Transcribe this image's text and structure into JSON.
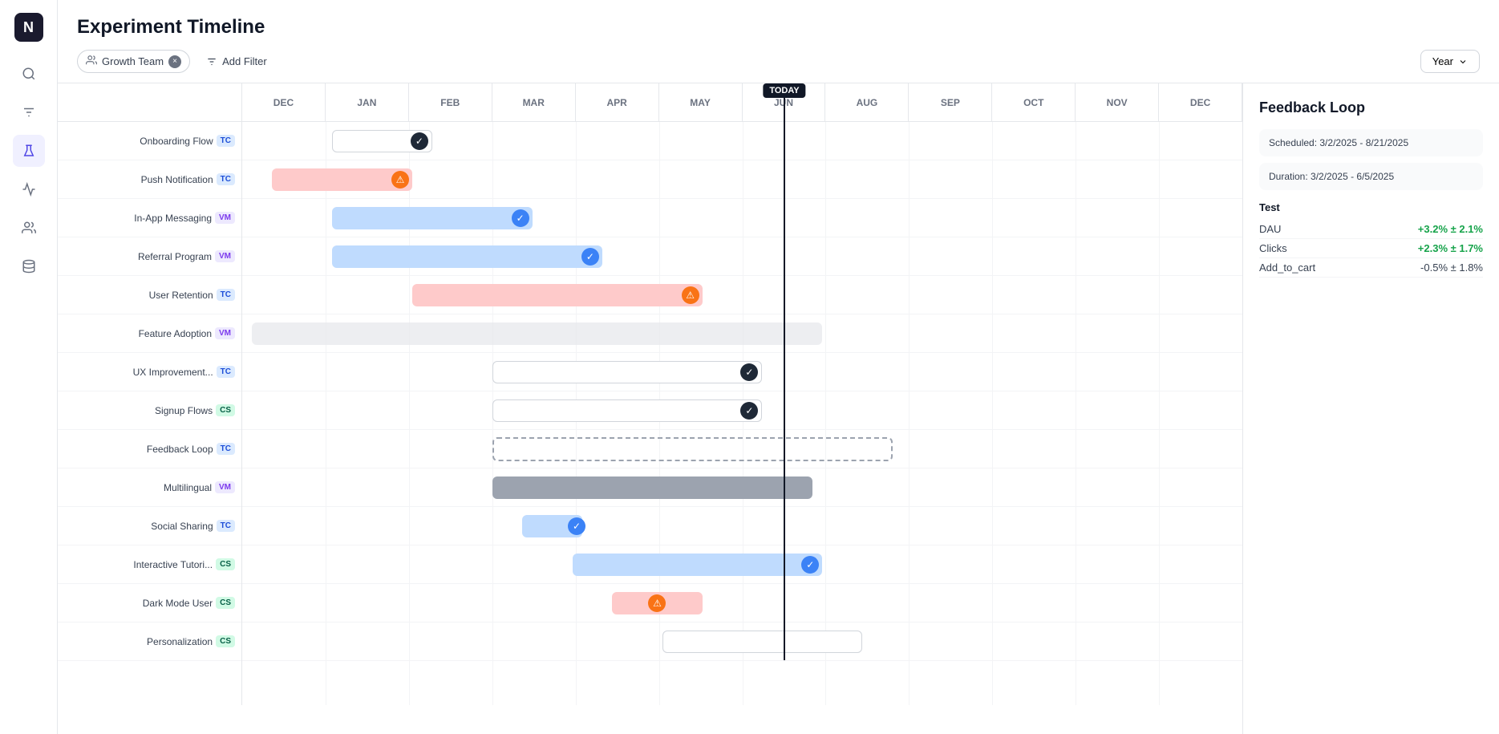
{
  "app": {
    "logo": "N",
    "title": "Experiment Timeline"
  },
  "sidebar": {
    "icons": [
      {
        "name": "search-icon",
        "symbol": "🔍"
      },
      {
        "name": "filter-icon",
        "symbol": "⚙️"
      },
      {
        "name": "experiment-icon",
        "symbol": "🧪",
        "active": true
      },
      {
        "name": "analytics-icon",
        "symbol": "📈"
      },
      {
        "name": "team-icon",
        "symbol": "👥"
      },
      {
        "name": "database-icon",
        "symbol": "🗄️"
      }
    ]
  },
  "header": {
    "title": "Experiment Timeline",
    "filter_chip_label": "Growth Team",
    "filter_chip_close": "×",
    "add_filter_label": "Add Filter",
    "year_label": "Year"
  },
  "months": [
    "DEC",
    "JAN",
    "FEB",
    "MAR",
    "APR",
    "MAY",
    "JUN",
    "AUG",
    "SEP",
    "OCT",
    "NOV",
    "DEC"
  ],
  "today_label": "TODAY",
  "rows": [
    {
      "label": "Onboarding Flow",
      "tag": "TC",
      "tag_class": "tag-tc"
    },
    {
      "label": "Push Notification",
      "tag": "TC",
      "tag_class": "tag-tc"
    },
    {
      "label": "In-App Messaging",
      "tag": "VM",
      "tag_class": "tag-vm"
    },
    {
      "label": "Referral Program",
      "tag": "VM",
      "tag_class": "tag-vm"
    },
    {
      "label": "User Retention",
      "tag": "TC",
      "tag_class": "tag-tc"
    },
    {
      "label": "Feature Adoption",
      "tag": "VM",
      "tag_class": "tag-vm"
    },
    {
      "label": "UX Improvement...",
      "tag": "TC",
      "tag_class": "tag-tc"
    },
    {
      "label": "Signup Flows",
      "tag": "CS",
      "tag_class": "tag-cs"
    },
    {
      "label": "Feedback Loop",
      "tag": "TC",
      "tag_class": "tag-tc"
    },
    {
      "label": "Multilingual",
      "tag": "VM",
      "tag_class": "tag-vm"
    },
    {
      "label": "Social Sharing",
      "tag": "TC",
      "tag_class": "tag-tc"
    },
    {
      "label": "Interactive Tutori...",
      "tag": "CS",
      "tag_class": "tag-cs"
    },
    {
      "label": "Dark Mode User",
      "tag": "CS",
      "tag_class": "tag-cs"
    },
    {
      "label": "Personalization",
      "tag": "CS",
      "tag_class": "tag-cs"
    }
  ],
  "popup": {
    "title": "Feedback Loop",
    "scheduled": "Scheduled: 3/2/2025 - 8/21/2025",
    "duration": "Duration: 3/2/2025 - 6/5/2025",
    "test_label": "Test",
    "metrics": [
      {
        "name": "DAU",
        "value": "+3.2% ± 2.1%",
        "class": "metric-pos"
      },
      {
        "name": "Clicks",
        "value": "+2.3% ± 1.7%",
        "class": "metric-pos"
      },
      {
        "name": "Add_to_cart",
        "value": "-0.5% ± 1.8%",
        "class": "metric-neg"
      }
    ]
  }
}
